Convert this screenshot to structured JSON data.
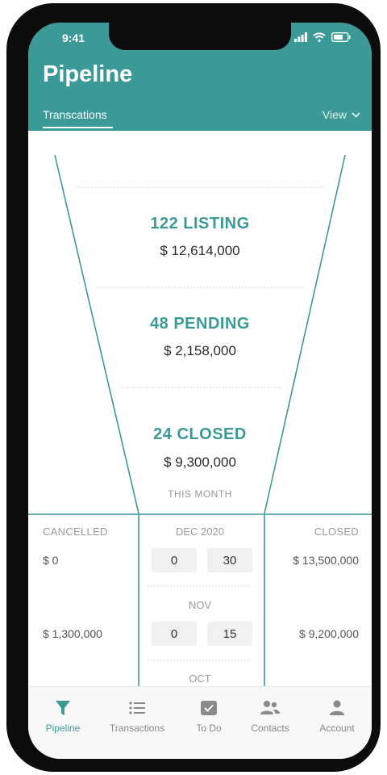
{
  "status_bar": {
    "time": "9:41"
  },
  "header": {
    "title": "Pipeline",
    "tab_label": "Transcations",
    "view_label": "View"
  },
  "funnel": {
    "stages": [
      {
        "title": "122 LISTING",
        "amount": "$ 12,614,000"
      },
      {
        "title": "48 PENDING",
        "amount": "$ 2,158,000"
      },
      {
        "title": "24 CLOSED",
        "amount": "$ 9,300,000"
      }
    ],
    "period_label": "THIS MONTH"
  },
  "summary": {
    "cancelled_header": "CANCELLED",
    "closed_header": "CLOSED",
    "months": [
      {
        "label": "DEC 2020",
        "cancelled_value": "$ 0",
        "count_a": "0",
        "count_b": "30",
        "closed_value": "$ 13,500,000"
      },
      {
        "label": "NOV",
        "cancelled_value": "$ 1,300,000",
        "count_a": "0",
        "count_b": "15",
        "closed_value": "$ 9,200,000"
      },
      {
        "label": "OCT"
      }
    ]
  },
  "tabbar": {
    "items": [
      {
        "label": "Pipeline",
        "icon": "funnel-icon",
        "active": true
      },
      {
        "label": "Transactions",
        "icon": "list-icon"
      },
      {
        "label": "To Do",
        "icon": "checkbox-icon"
      },
      {
        "label": "Contacts",
        "icon": "contacts-icon"
      },
      {
        "label": "Account",
        "icon": "person-icon"
      }
    ]
  },
  "colors": {
    "accent": "#3b9a98",
    "text_muted": "#9a9a9a"
  }
}
